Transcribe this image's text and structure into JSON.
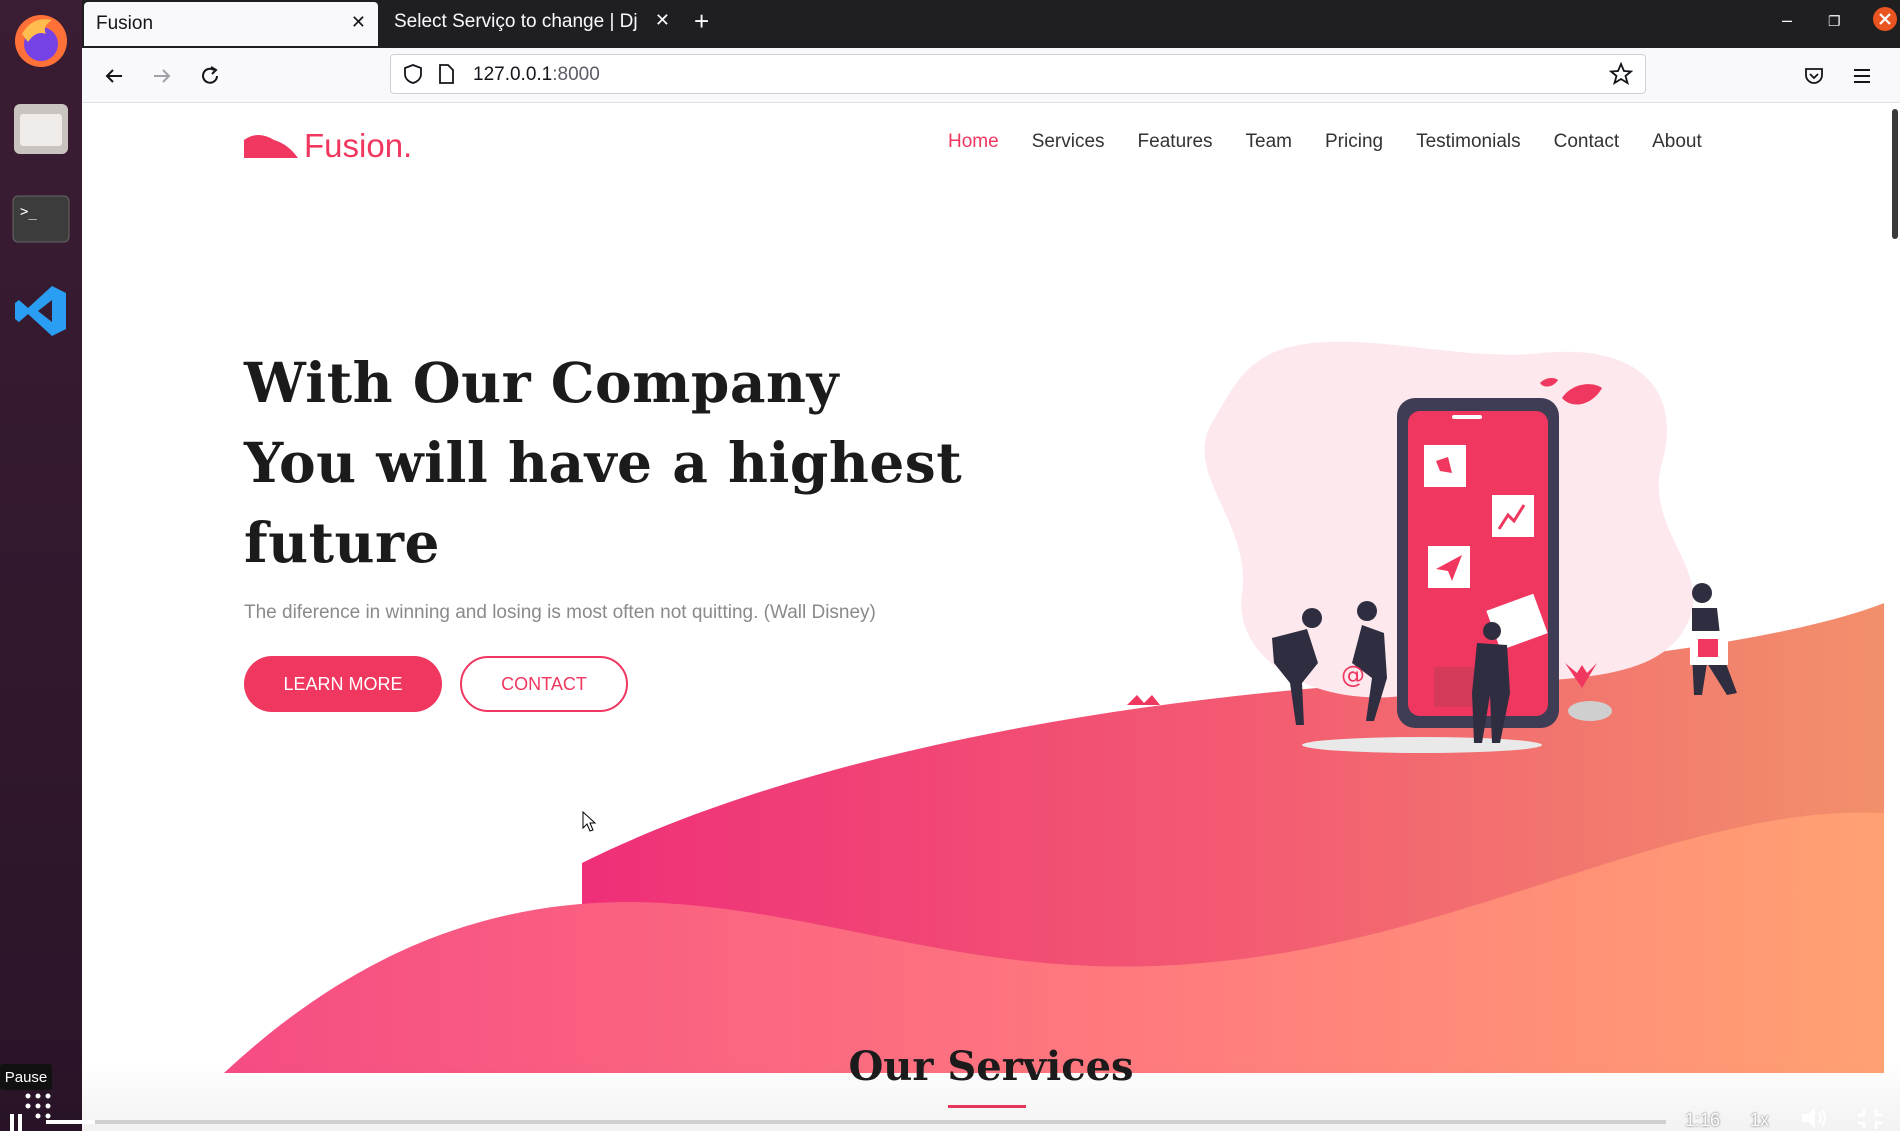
{
  "browser": {
    "tabs": [
      {
        "title": "Fusion",
        "active": true
      },
      {
        "title": "Select Serviço to change | Dj",
        "active": false
      }
    ],
    "url_host": "127.0.0.1",
    "url_port": ":8000"
  },
  "site": {
    "logo_text": "Fusion.",
    "nav": [
      {
        "label": "Home",
        "active": true
      },
      {
        "label": "Services",
        "active": false
      },
      {
        "label": "Features",
        "active": false
      },
      {
        "label": "Team",
        "active": false
      },
      {
        "label": "Pricing",
        "active": false
      },
      {
        "label": "Testimonials",
        "active": false
      },
      {
        "label": "Contact",
        "active": false
      },
      {
        "label": "About",
        "active": false
      }
    ],
    "hero": {
      "title_line1": "With Our Company",
      "title_line2": "You will have a highest",
      "title_line3": "future",
      "subtitle": "The diference in winning and losing is most often not quitting. (Wall Disney)",
      "primary_button": "LEARN MORE",
      "secondary_button": "CONTACT"
    },
    "services_heading": "Our Services",
    "colors": {
      "accent": "#f0375f",
      "wave_end": "#ff9d6c"
    }
  },
  "video_player": {
    "pause_label": "Pause",
    "time": "1:16",
    "speed": "1x",
    "progress": 0.03
  }
}
